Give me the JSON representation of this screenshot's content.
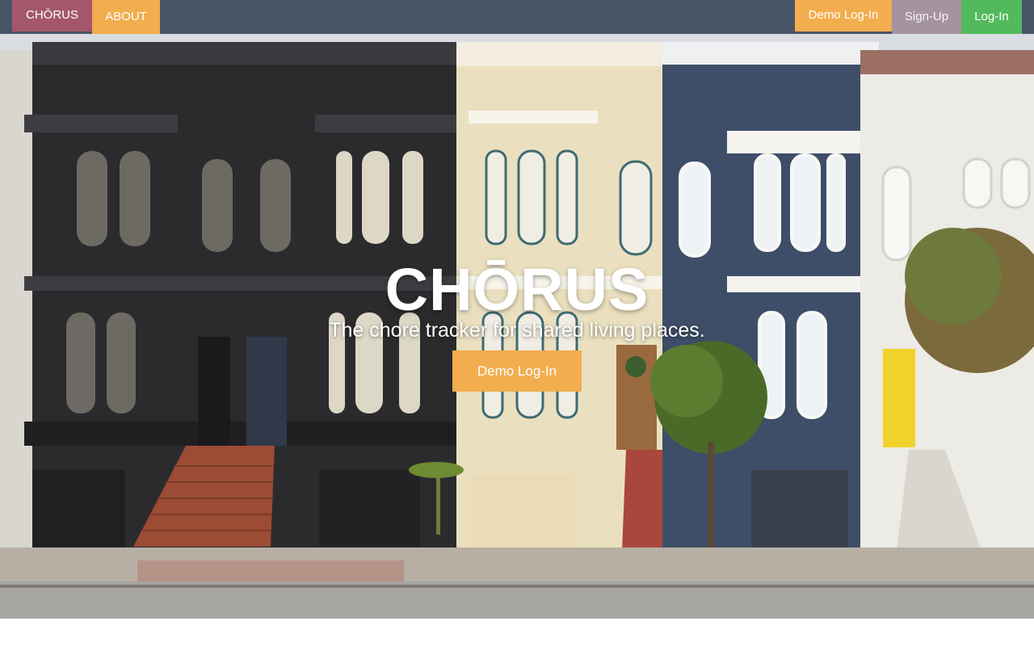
{
  "navbar": {
    "logo_label": "CHŌRUS",
    "about_label": "ABOUT",
    "demo_login_label": "Demo Log-In",
    "signup_label": "Sign-Up",
    "login_label": "Log-In"
  },
  "hero": {
    "title": "CHŌRUS",
    "tagline": "The chore tracker for shared living places.",
    "cta_label": "Demo Log-In"
  },
  "colors": {
    "navbar_bg": "#485567",
    "logo_bg": "#a4576b",
    "accent_orange": "#f2ad4e",
    "signup_bg": "#a5949e",
    "login_bg": "#52ba5b"
  }
}
